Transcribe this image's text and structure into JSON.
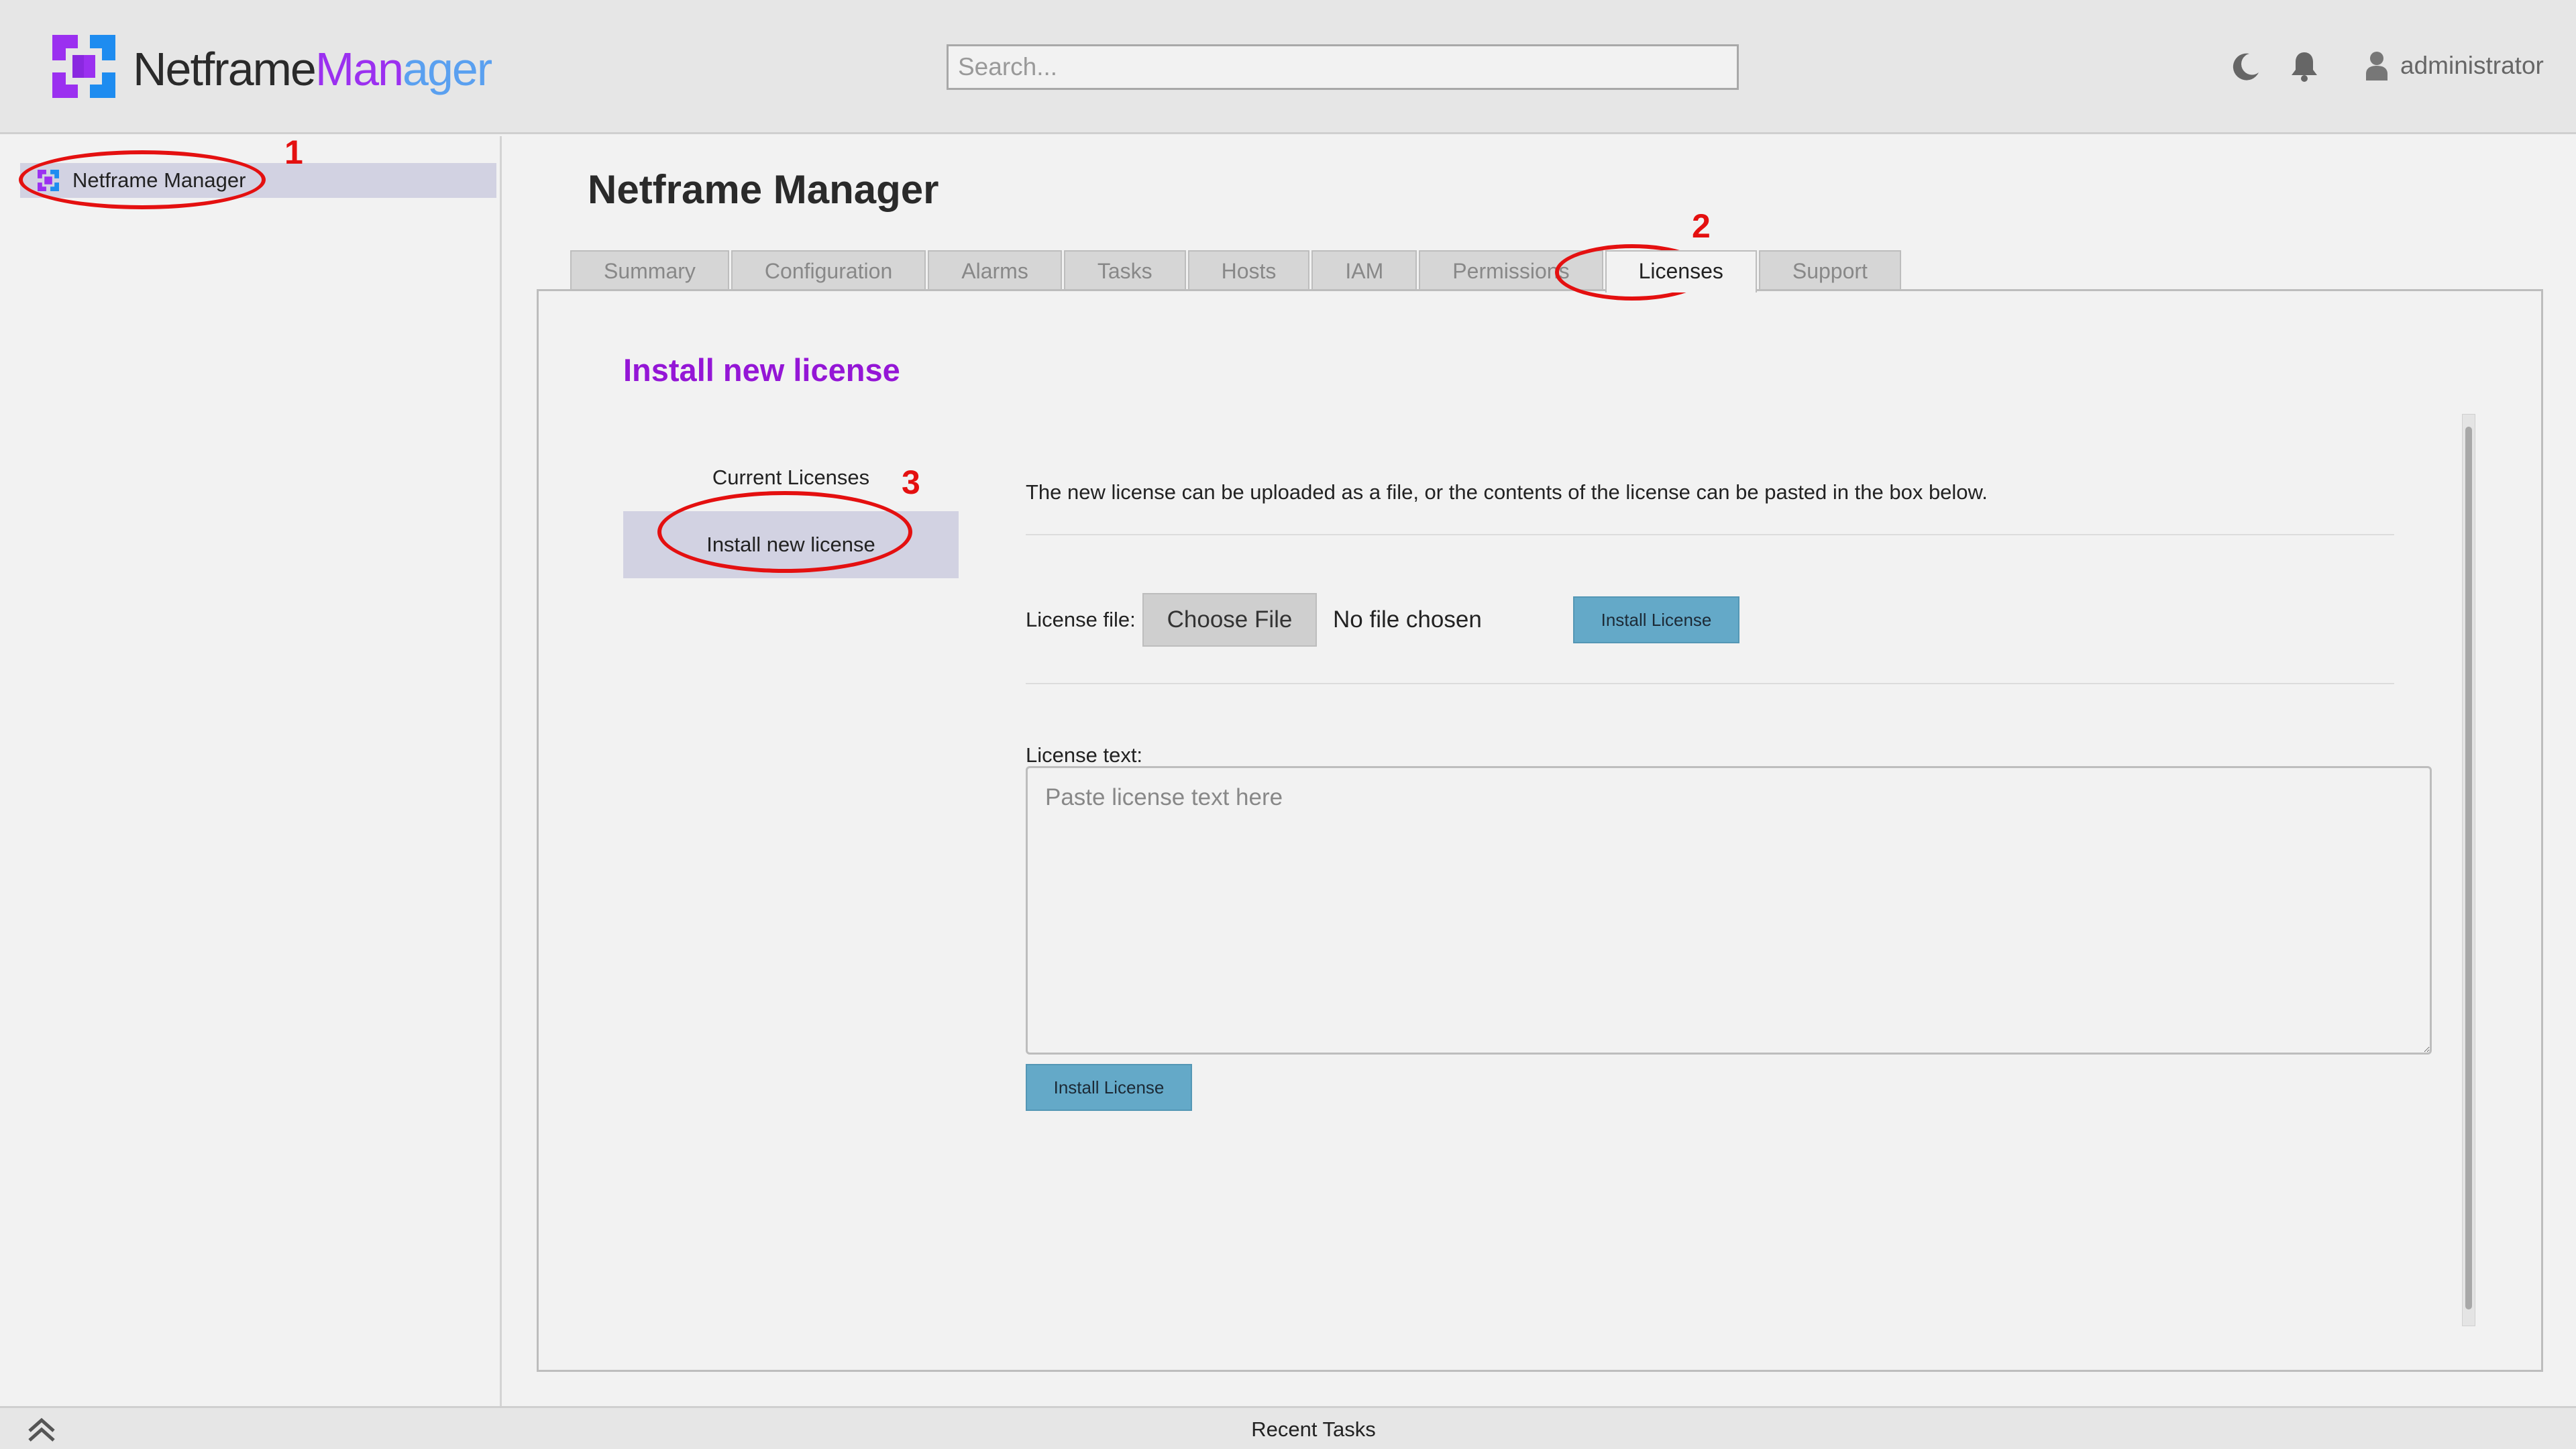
{
  "header": {
    "brand_part1": "Netframe",
    "brand_part2": "Man",
    "brand_part3": "ager",
    "search_placeholder": "Search...",
    "user_name": "administrator",
    "icons": [
      "logo-icon",
      "moon-icon",
      "bell-icon",
      "user-icon"
    ]
  },
  "sidebar": {
    "items": [
      {
        "label": "Netframe Manager",
        "icon": "netframe-logo-icon",
        "selected": true
      }
    ]
  },
  "main": {
    "page_title": "Netframe Manager",
    "tabs": [
      {
        "label": "Summary"
      },
      {
        "label": "Configuration"
      },
      {
        "label": "Alarms"
      },
      {
        "label": "Tasks"
      },
      {
        "label": "Hosts"
      },
      {
        "label": "IAM"
      },
      {
        "label": "Permissions"
      },
      {
        "label": "Licenses",
        "active": true
      },
      {
        "label": "Support"
      }
    ],
    "section_title": "Install new license",
    "subnav": [
      {
        "label": "Current Licenses"
      },
      {
        "label": "Install new license",
        "active": true
      }
    ],
    "description": "The new license can be uploaded as a file, or the contents of the license can be pasted in the box below.",
    "license_file_label": "License file:",
    "choose_file_label": "Choose File",
    "no_file_text": "No file chosen",
    "install_button_label": "Install License",
    "license_text_label": "License text:",
    "license_text_placeholder": "Paste license text here"
  },
  "footer": {
    "label": "Recent Tasks"
  },
  "annotations": [
    {
      "number": "1"
    },
    {
      "number": "2"
    },
    {
      "number": "3"
    }
  ],
  "colors": {
    "accent_purple": "#9416d6",
    "button_blue": "#64a9c8",
    "selected_bg": "#d2d2e2",
    "annotation_red": "#e41010"
  }
}
